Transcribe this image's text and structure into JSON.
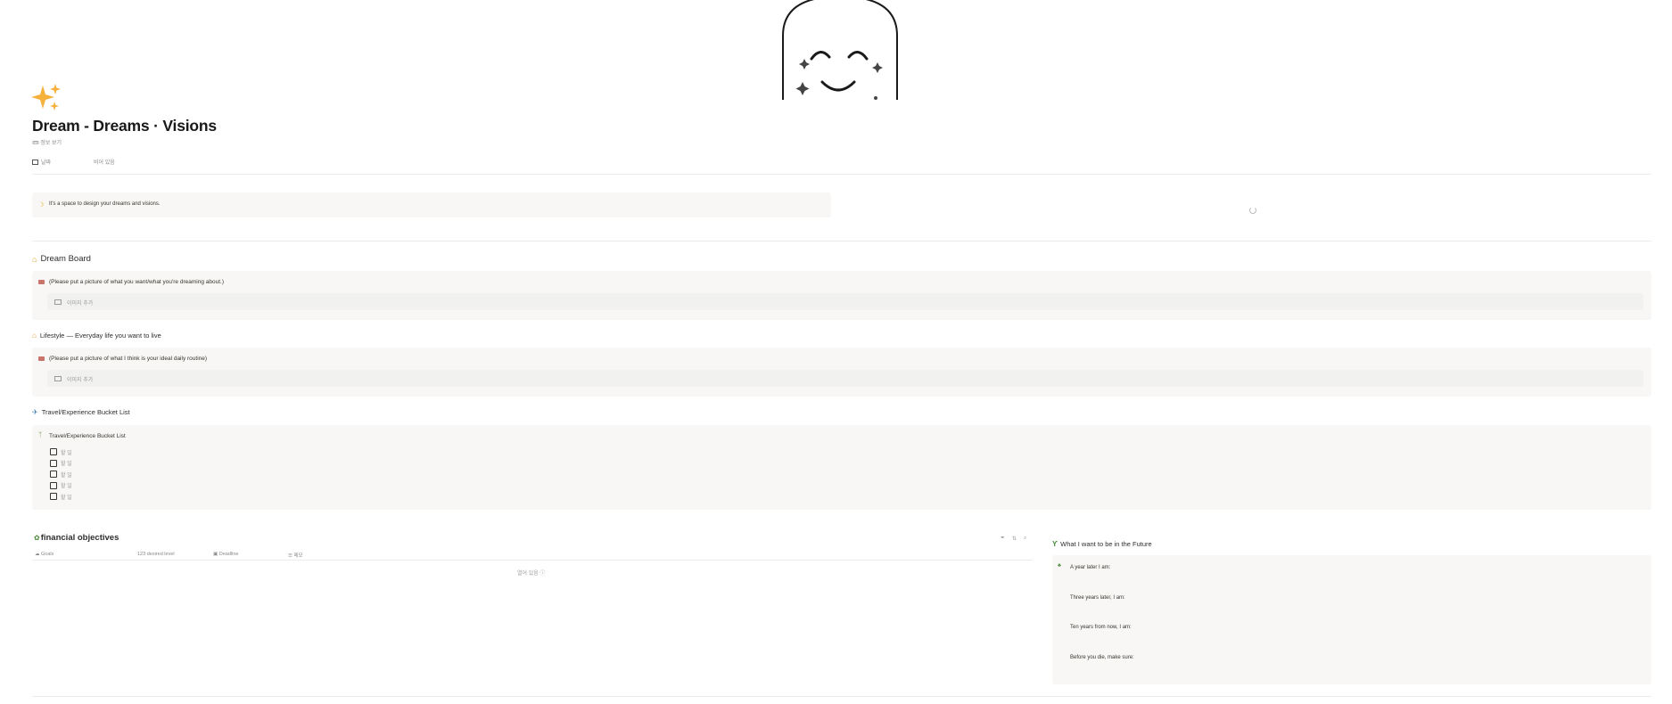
{
  "page": {
    "icon": "sparkles-icon",
    "title": "Dream - Dreams · Visions",
    "subtitle": "🎟 정보 보기",
    "props": {
      "date_label": "날짜",
      "date_value": "비어 있음"
    }
  },
  "intro": {
    "text": "It's a space to design your dreams and visions."
  },
  "dream_board": {
    "heading": "Dream Board",
    "callout": "(Please put a picture of what you want/what you're dreaming about.)",
    "add_image": "이미지 추가"
  },
  "lifestyle": {
    "heading": "Lifestyle — Everyday life you want to live",
    "callout": "(Please put a picture of what I think is your ideal daily routine)",
    "add_image": "이미지 추가"
  },
  "travel": {
    "heading": "Travel/Experience Bucket List",
    "callout_title": "Travel/Experience Bucket List",
    "todos": [
      "할 일",
      "할 일",
      "할 일",
      "할 일",
      "할 일"
    ]
  },
  "finance": {
    "heading": "financial objectives",
    "columns": [
      "Goals",
      "desired level",
      "Deadline",
      "메모"
    ],
    "new_label": "열어 있음"
  },
  "future": {
    "heading": "What I want to be in the Future",
    "items": [
      "A year later I am:",
      "Three years later, I am:",
      "Ten years from now, I am:",
      "Before you die, make sure:"
    ]
  },
  "colors": {
    "callout_bg": "#f8f7f5",
    "placeholder_bg": "#f1f1ef",
    "sparkle": "#f6b03c"
  }
}
